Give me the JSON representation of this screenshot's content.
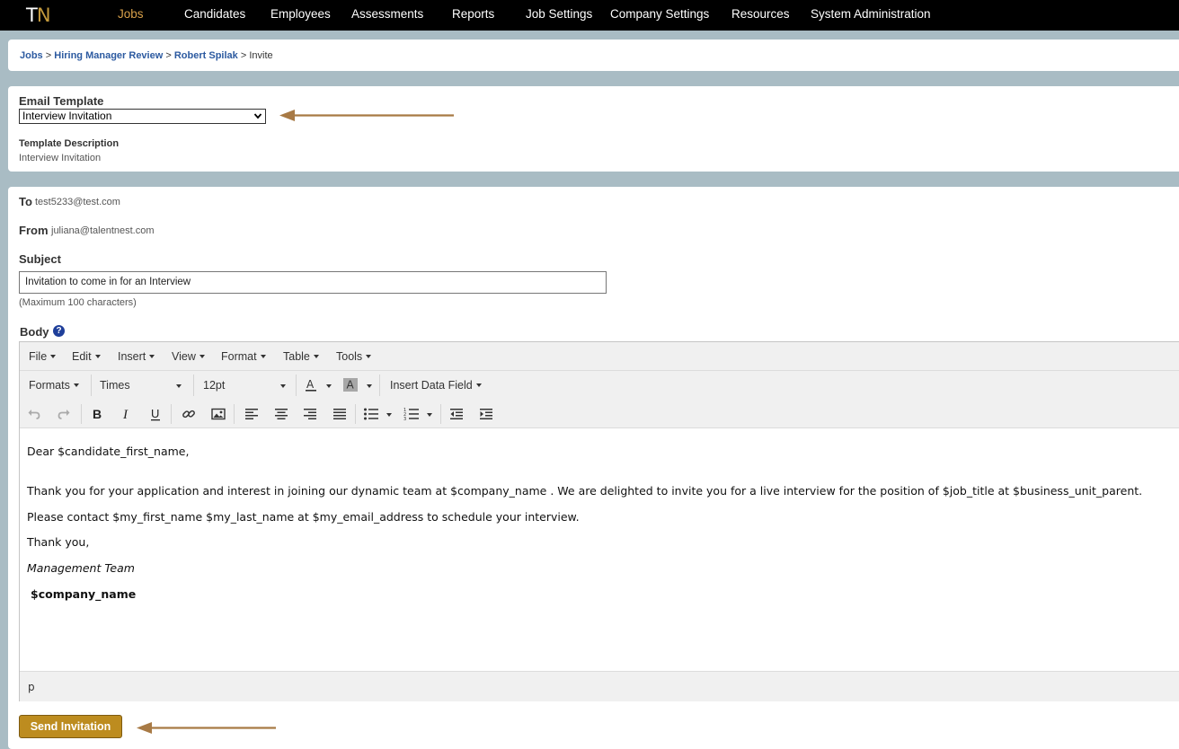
{
  "nav": {
    "logo_t": "T",
    "logo_n": "N",
    "items": [
      "Jobs",
      "Candidates",
      "Employees",
      "Assessments",
      "Reports",
      "Job Settings",
      "Company Settings",
      "Resources",
      "System Administration"
    ],
    "active": "Jobs",
    "active_color": "#d9a14a"
  },
  "breadcrumb": {
    "jobs": "Jobs",
    "review": "Hiring Manager Review",
    "candidate": "Robert Spilak",
    "current": "Invite",
    "sep": ">"
  },
  "template": {
    "label": "Email Template",
    "selected": "Interview Invitation",
    "desc_label": "Template Description",
    "desc_value": "Interview Invitation"
  },
  "email": {
    "to_label": "To",
    "to_value": "test5233@test.com",
    "from_label": "From",
    "from_value": "juliana@talentnest.com",
    "subject_label": "Subject",
    "subject_value": "Invitation to come in for an Interview",
    "subject_hint": "(Maximum 100 characters)",
    "body_label": "Body",
    "help_glyph": "?"
  },
  "editor": {
    "menus": [
      "File",
      "Edit",
      "Insert",
      "View",
      "Format",
      "Table",
      "Tools"
    ],
    "formats": "Formats",
    "font": "Times",
    "size": "12pt",
    "insert_field": "Insert Data Field",
    "body_lines": [
      "Dear $candidate_first_name,",
      "Thank you for your application and interest in joining our dynamic team at  $company_name . We are delighted to invite you for a live interview for the position of $job_title at $business_unit_parent.",
      "Please contact $my_first_name $my_last_name at $my_email_address to schedule your interview.",
      "Thank you,",
      "Management Team",
      "$company_name"
    ],
    "status_path": "p"
  },
  "actions": {
    "send_label": "Send Invitation"
  },
  "colors": {
    "accent": "#bd8c1f",
    "arrow": "#a87a45",
    "link": "#2c5aa0",
    "background": "#a9bcc4"
  }
}
